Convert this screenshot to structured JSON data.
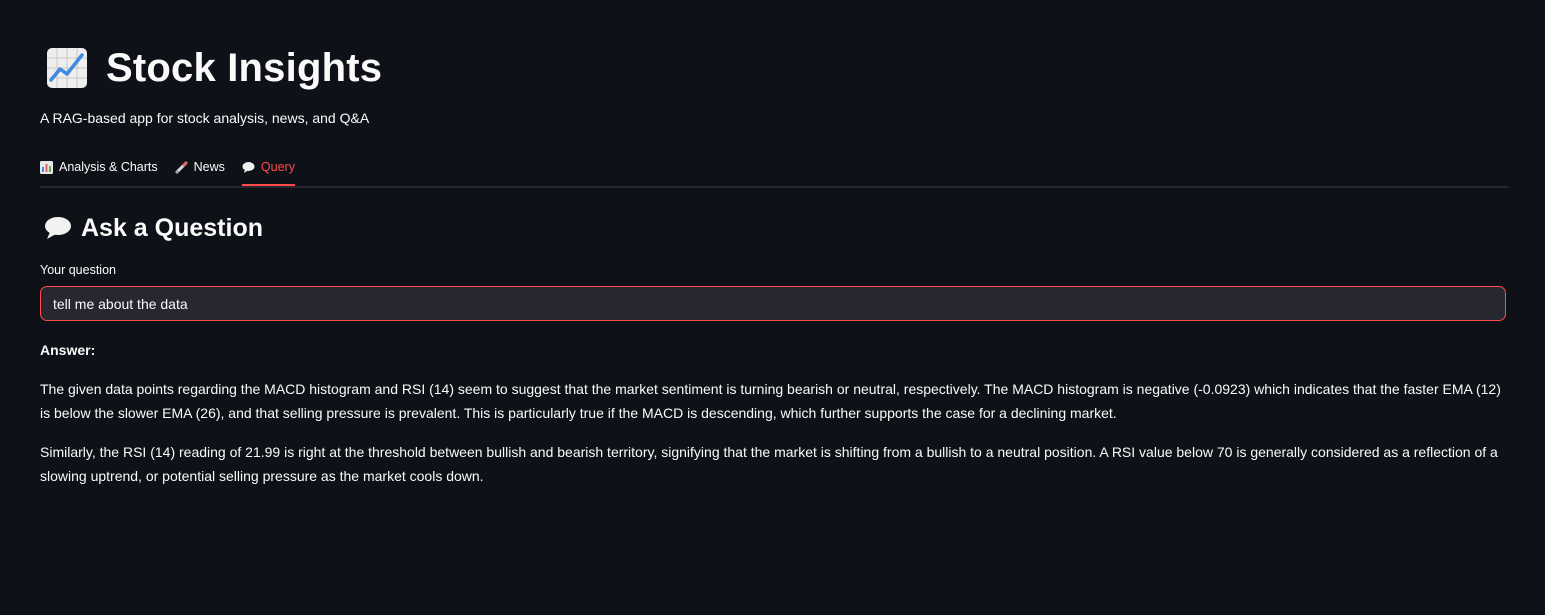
{
  "header": {
    "title": "Stock Insights",
    "title_icon": "chart-increasing-icon",
    "subtitle": "A RAG-based app for stock analysis, news, and Q&A"
  },
  "tabs": [
    {
      "label": "Analysis & Charts",
      "icon": "bar-chart-icon",
      "active": false
    },
    {
      "label": "News",
      "icon": "pencil-icon",
      "active": false
    },
    {
      "label": "Query",
      "icon": "speech-bubble-icon",
      "active": true
    }
  ],
  "query": {
    "section_title": "Ask a Question",
    "section_icon": "speech-bubble-icon",
    "field_label": "Your question",
    "field_value": "tell me about the data",
    "answer_label": "Answer:",
    "answer_paragraphs": [
      "The given data points regarding the MACD histogram and RSI (14) seem to suggest that the market sentiment is turning bearish or neutral, respectively. The MACD histogram is negative (-0.0923) which indicates that the faster EMA (12) is below the slower EMA (26), and that selling pressure is prevalent. This is particularly true if the MACD is descending, which further supports the case for a declining market.",
      "Similarly, the RSI (14) reading of 21.99 is right at the threshold between bullish and bearish territory, signifying that the market is shifting from a bullish to a neutral position. A RSI value below 70 is generally considered as a reflection of a slowing uptrend, or potential selling pressure as the market cools down."
    ]
  },
  "colors": {
    "background": "#0e1117",
    "text": "#fafafa",
    "accent": "#ff4b4b",
    "input_background": "#262730"
  }
}
